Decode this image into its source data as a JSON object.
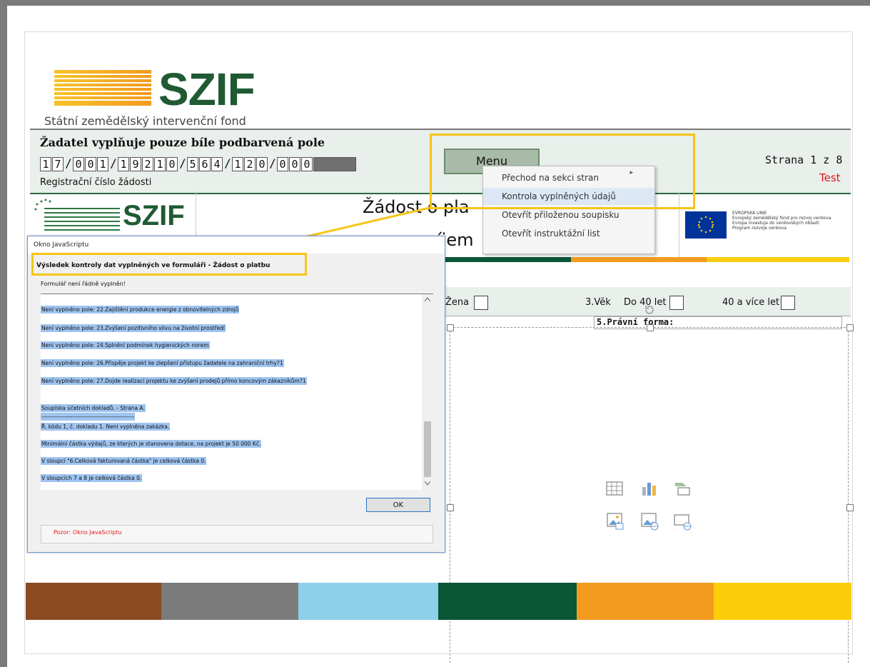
{
  "logo": {
    "name": "SZIF",
    "subtitle": "Státní zemědělský intervenční fond"
  },
  "form_header": {
    "title": "Žadatel vyplňuje pouze bíle podbarvená pole",
    "registration_digits": [
      "1",
      "7",
      "/",
      "0",
      "0",
      "1",
      "/",
      "1",
      "9",
      "2",
      "1",
      "0",
      "/",
      "5",
      "6",
      "4",
      "/",
      "1",
      "2",
      "0",
      "/",
      "0",
      "0",
      "0"
    ],
    "registration_label": "Registrační číslo žádosti",
    "menu_button": "Menu",
    "page_indicator": "Strana 1 z 8",
    "test_label": "Test"
  },
  "context_menu": {
    "items": [
      {
        "label": "Přechod na sekci stran",
        "has_submenu": true
      },
      {
        "label": "Kontrola vyplněných údajů",
        "highlighted": true
      },
      {
        "label": "Otevřít přiloženou soupisku"
      },
      {
        "label": "Otevřít instruktážní list"
      }
    ],
    "submenu_arrow": "▸"
  },
  "document": {
    "inner_logo": "SZIF",
    "title_line1": "Žádost o pla",
    "title_line2": "íjem",
    "eu_text": [
      "EVROPSKÁ UNIE",
      "Evropský zemědělský fond pro rozvoj venkova",
      "Evropa investuje do venkovských oblastí",
      "Program rozvoje venkova"
    ],
    "zena_label": "Žena",
    "age_label": "3.Věk",
    "under40_label": "Do 40 let",
    "over40_label": "40 a více let",
    "legal_form_label": "5.Právní forma:"
  },
  "colors": {
    "brown": "#8b4a21",
    "grey": "#7b7b7b",
    "light_blue": "#8dd0ea",
    "dark_green": "#0b5637",
    "orange": "#f39a1f",
    "yellow": "#fdcc0a",
    "highlight": "#f5c518"
  },
  "dialog": {
    "window_title": "Okno JavaScriptu",
    "heading": "Výsledek kontroly dat vyplněných ve formuláři - Žádost o platbu",
    "subheading": "Formulář není řádně vyplněn!",
    "lines": [
      "Není vyplněno pole: 22.Zajištění produkce energie z obnovitelných zdrojů",
      "Není vyplněno pole: 23.Zvýšení pozitivního vlivu na životní prostředí",
      "Není vyplněno pole: 24.Splnění podmínek hygienických norem",
      "Není vyplněno pole: 26.Přispěje projekt ke zlepšení přístupu žadatele na zahraniční trhy?1",
      "Není vyplněno pole: 27.Dojde realizací projektu ke zvýšení prodejů přímo koncovým zákazníkům?1",
      "Soupiska účetních dokladů. - Strana A.",
      "------------------------------------------------",
      "Ř. kódu 1, č. dokladu 1. Není vyplněna zakázka.",
      "Minimální částka výdajů, ze kterých je stanovena dotace, na projekt je 50 000 Kč.",
      "V sloupci \"6.Celková fakturovaná částka\" je celková částka 0.",
      "V sloupcích 7 a 8 je celková částka 0."
    ],
    "ok_button": "OK",
    "warning": "Pozor: Okno JavaScriptu"
  }
}
